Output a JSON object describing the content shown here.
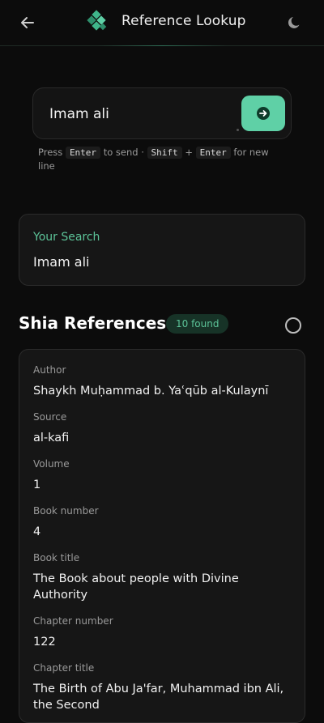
{
  "header": {
    "title": "Reference Lookup",
    "back_icon": "arrow-left-icon",
    "logo_icon": "logo-diamond-icon",
    "theme_icon": "moon-icon"
  },
  "search_input": {
    "value": "Imam ali",
    "send_icon": "arrow-right-circle-icon"
  },
  "hint": {
    "press": "Press",
    "enter_key": "Enter",
    "to_send": "to send ·",
    "shift_key": "Shift",
    "plus": "+",
    "enter_key2": "Enter",
    "new_line": "for new line"
  },
  "your_search": {
    "label": "Your Search",
    "value": "Imam ali"
  },
  "results": {
    "title": "Shia References",
    "count_badge": "10 found"
  },
  "reference": {
    "fields": [
      {
        "label": "Author",
        "value": "Shaykh Muḥammad b. Yaʿqūb al-Kulaynī"
      },
      {
        "label": "Source",
        "value": "al-kafi"
      },
      {
        "label": "Volume",
        "value": "1"
      },
      {
        "label": "Book number",
        "value": "4"
      },
      {
        "label": "Book title",
        "value": "The Book about people with Divine Authority"
      },
      {
        "label": "Chapter number",
        "value": "122"
      },
      {
        "label": "Chapter title",
        "value": "The Birth of Abu Ja'far, Muhammad ibn Ali, the Second"
      }
    ]
  },
  "colors": {
    "accent": "#5fd0a6",
    "accent_text": "#5cc398",
    "background": "#0c0c0c",
    "card": "#161616"
  }
}
